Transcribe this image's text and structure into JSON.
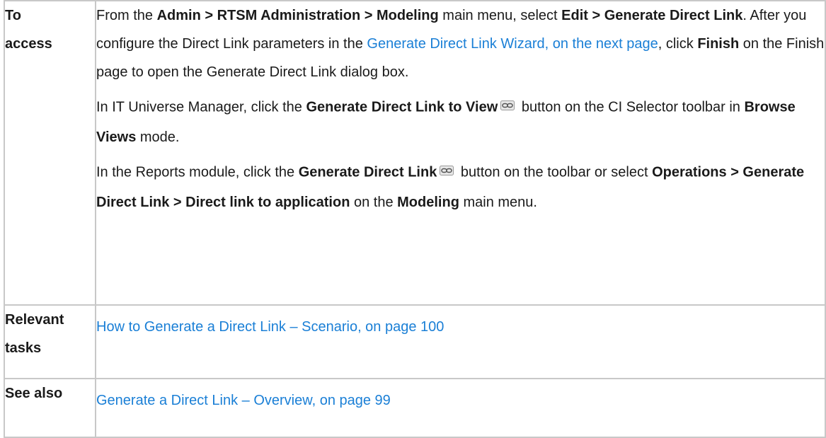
{
  "rows": {
    "access": {
      "label_line1": "To",
      "label_line2": "access",
      "p1": {
        "t1": "From the ",
        "b1": "Admin > RTSM Administration > Modeling",
        "t2": " main menu, select ",
        "b2": "Edit > Generate Direct Link",
        "t3": ". After you configure the Direct Link parameters in the ",
        "link": "Generate Direct Link Wizard, on the next page",
        "t4": ", click ",
        "b3": "Finish",
        "t5": " on the Finish page to open the Generate Direct Link dialog box."
      },
      "p2": {
        "t1": "In IT Universe Manager, click the ",
        "b1": "Generate Direct Link to View",
        "t2": " button on the CI Selector toolbar in ",
        "b2": "Browse Views",
        "t3": " mode."
      },
      "p3": {
        "t1": "In the Reports module, click the ",
        "b1": "Generate Direct Link",
        "t2": " button on the toolbar or select ",
        "b2": "Operations > Generate Direct Link > Direct link to application",
        "t3": " on the ",
        "b3": "Modeling",
        "t4": " main menu."
      }
    },
    "tasks": {
      "label_line1": "Relevant",
      "label_line2": "tasks",
      "link": "How to Generate a Direct Link – Scenario, on page 100"
    },
    "see_also": {
      "label": "See also",
      "link": "Generate a Direct Link – Overview, on page 99"
    }
  },
  "icons": {
    "toolbar_icon": "chain-link-icon"
  },
  "colors": {
    "link": "#1a7fd6",
    "border": "#c8c8c8"
  }
}
